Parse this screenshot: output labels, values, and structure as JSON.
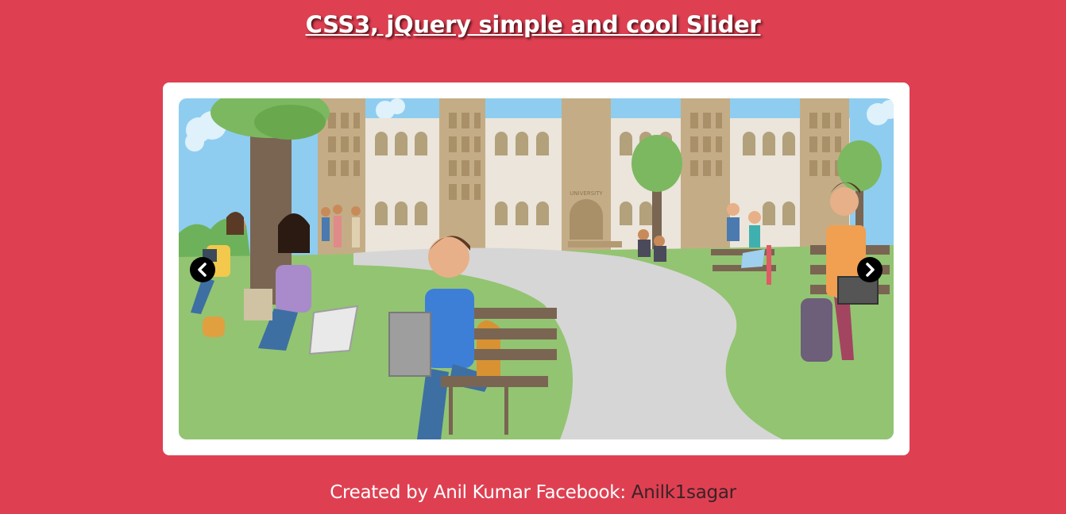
{
  "header": {
    "title": "CSS3, jQuery simple and cool Slider"
  },
  "slider": {
    "current_slide": {
      "image": "university-campus-illustration",
      "building_sign": "UNIVERSITY"
    },
    "prev_icon": "chevron-left-icon",
    "next_icon": "chevron-right-icon"
  },
  "footer": {
    "prefix": "Created by Anil Kumar Facebook:",
    "link_text": "Anilk1sagar"
  },
  "colors": {
    "background": "#de4052",
    "frame": "#ffffff",
    "link": "#3a2226",
    "arrow": "#000000"
  }
}
